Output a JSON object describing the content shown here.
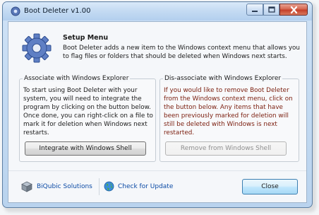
{
  "window": {
    "title": "Boot Deleter v1.00"
  },
  "header": {
    "title": "Setup Menu",
    "description": "Boot Deleter adds a new item to the Windows context menu that allows you to flag files or folders that should be deleted when Windows next starts."
  },
  "associate": {
    "title": "Associate with Windows Explorer",
    "text": "To start using Boot Deleter with your system, you will need to integrate the program by clicking on the button below. Once done, you can right-click on a file to mark it for deletion when Windows next restarts.",
    "button_label": "Integrate with Windows Shell"
  },
  "disassociate": {
    "title": "Dis-associate with Windows Explorer",
    "text": "If you would like to remove Boot Deleter from the Windows context menu, click on the button below. Any items that have been previously marked for deletion will still be deleted with Windows is next restarted.",
    "button_label": "Remove from Windows Shell"
  },
  "footer": {
    "biqubic_label": "BiQubic Solutions",
    "update_label": "Check for Update",
    "close_label": "Close"
  },
  "icons": {
    "app": "app-icon",
    "gear": "gear-icon",
    "biqubic": "cube-icon",
    "update": "globe-icon"
  }
}
